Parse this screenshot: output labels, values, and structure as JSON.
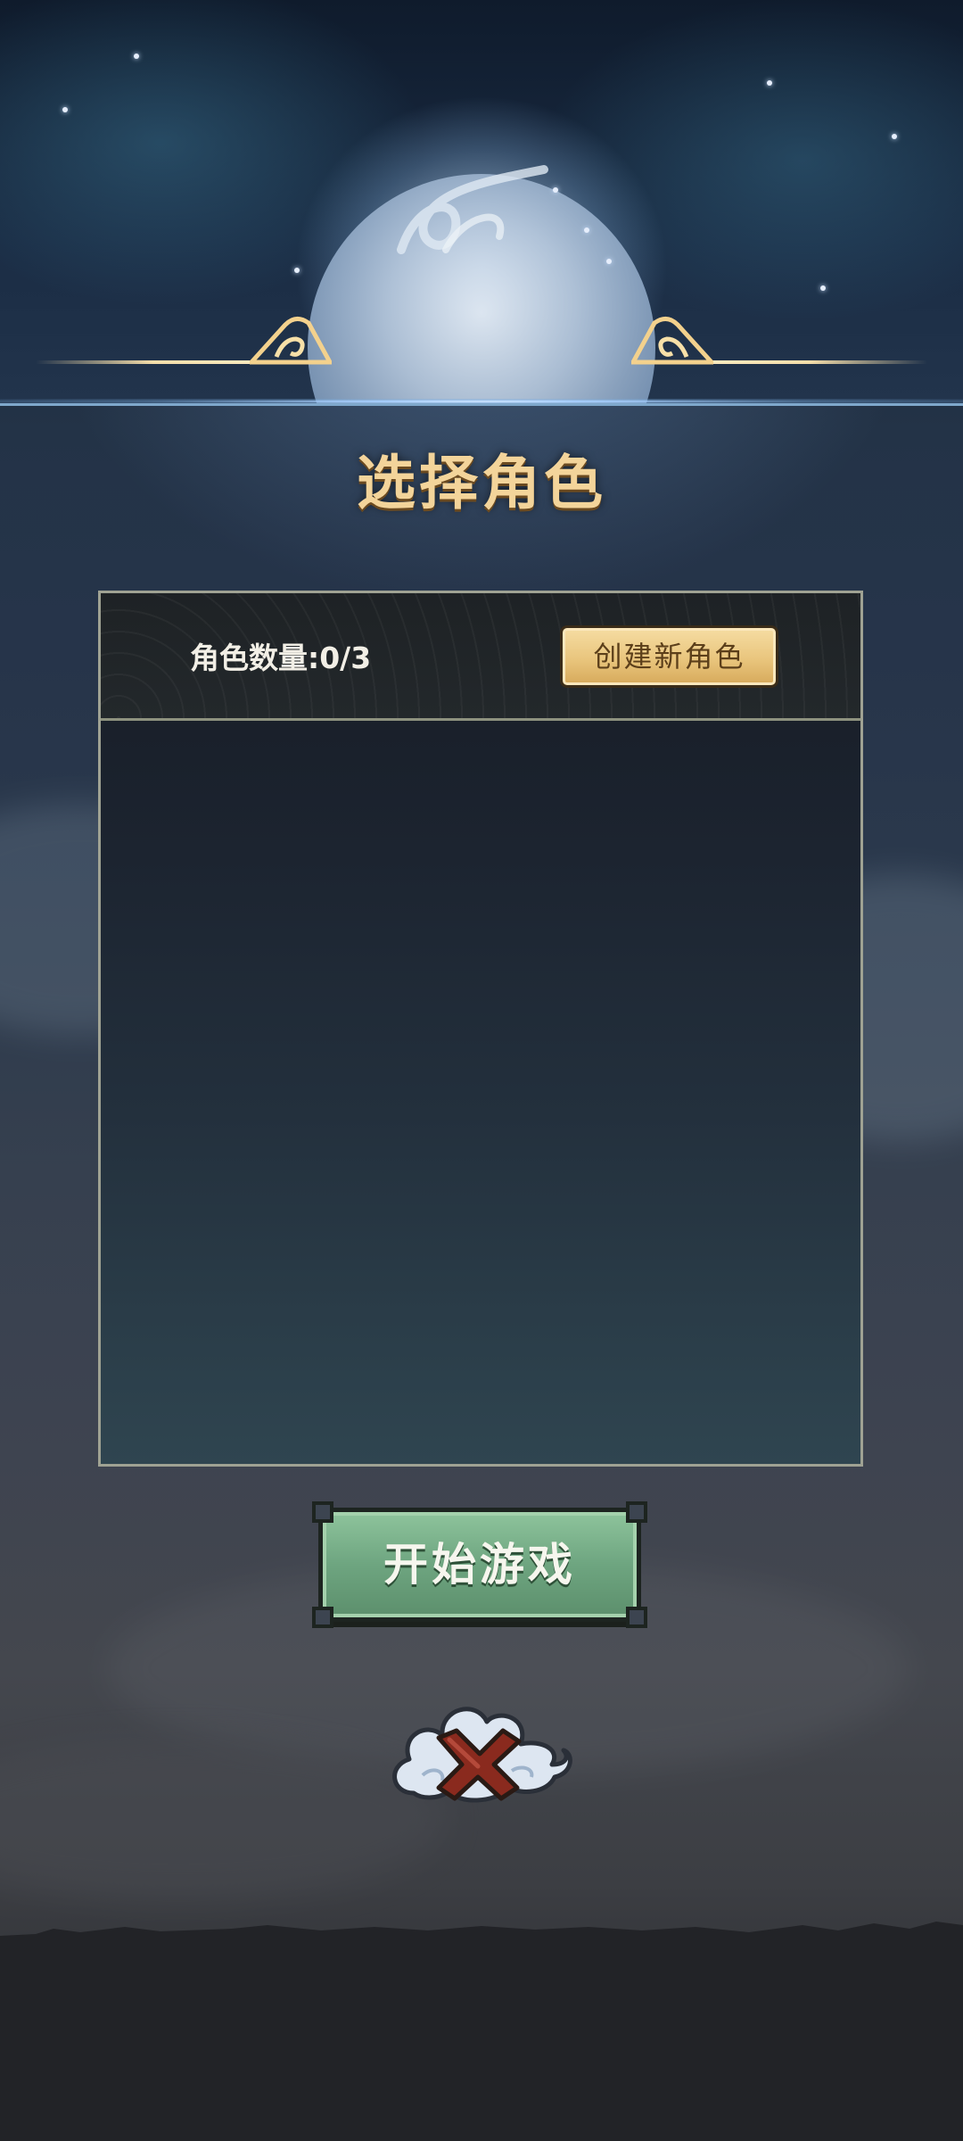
{
  "screen": {
    "title": "选择角色"
  },
  "panel": {
    "role_count": "角色数量:0/3",
    "create_button": "创建新角色",
    "roles": []
  },
  "actions": {
    "start_button": "开始游戏",
    "close_icon": "cloud-close-icon"
  },
  "colors": {
    "title_gold": "#f3d49a",
    "create_button_gold": "#e9c57d",
    "start_button_green": "#6ea580",
    "close_x_red": "#8a2a1e"
  }
}
